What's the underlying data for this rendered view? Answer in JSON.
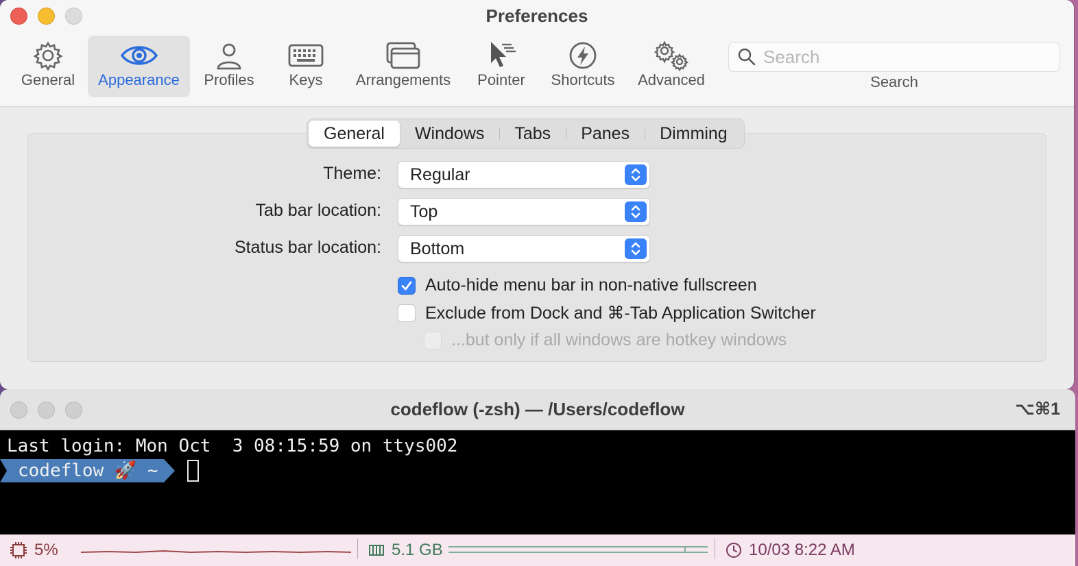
{
  "prefs": {
    "title": "Preferences",
    "toolbar": [
      {
        "label": "General",
        "icon": "gear-icon"
      },
      {
        "label": "Appearance",
        "icon": "eye-icon",
        "active": true
      },
      {
        "label": "Profiles",
        "icon": "person-icon"
      },
      {
        "label": "Keys",
        "icon": "keyboard-icon"
      },
      {
        "label": "Arrangements",
        "icon": "windows-icon"
      },
      {
        "label": "Pointer",
        "icon": "pointer-icon"
      },
      {
        "label": "Shortcuts",
        "icon": "lightning-icon"
      },
      {
        "label": "Advanced",
        "icon": "gears-icon"
      }
    ],
    "search": {
      "placeholder": "Search",
      "caption": "Search"
    },
    "tabs": [
      "General",
      "Windows",
      "Tabs",
      "Panes",
      "Dimming"
    ],
    "active_tab": "General",
    "fields": {
      "theme": {
        "label": "Theme:",
        "value": "Regular"
      },
      "tab_bar": {
        "label": "Tab bar location:",
        "value": "Top"
      },
      "status_bar": {
        "label": "Status bar location:",
        "value": "Bottom"
      }
    },
    "checks": {
      "autohide": {
        "label": "Auto-hide menu bar in non-native fullscreen",
        "checked": true
      },
      "exclude": {
        "label": "Exclude from Dock and ⌘-Tab Application Switcher",
        "checked": false
      },
      "hotkey": {
        "label": "...but only if all windows are hotkey windows",
        "checked": false,
        "disabled": true
      }
    },
    "accent_color": "#3a82f7"
  },
  "terminal": {
    "title": "codeflow (-zsh) — /Users/codeflow",
    "shortcut": "⌥⌘1",
    "login_line": "Last login: Mon Oct  3 08:15:59 on ttys002",
    "prompt": "codeflow 🚀 ~",
    "status": {
      "cpu": "5%",
      "memory": "5.1 GB",
      "clock": "10/03 8:22 AM"
    }
  }
}
